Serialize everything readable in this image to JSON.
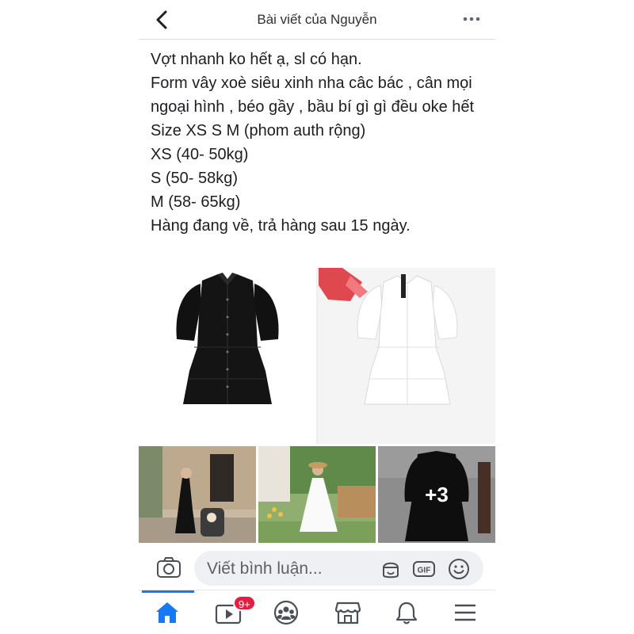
{
  "header": {
    "title": "Bài viết của Nguyễn"
  },
  "post": {
    "lines": [
      "Vợt nhanh ko hết ạ, sl có hạn.",
      "Form vây xoè siêu xinh nha câc bác , cân mọi ngoại hình , béo gầy , bầu bí gì gì đều oke hết",
      "Size XS S M (phom auth rộng)",
      "XS (40- 50kg)",
      "S (50- 58kg)",
      "M (58- 65kg)",
      "Hàng đang về, trả hàng sau 15 ngày."
    ]
  },
  "gallery": {
    "more_count": "+3"
  },
  "comment": {
    "placeholder": "Viết bình luận..."
  },
  "tabbar": {
    "video_badge": "9+"
  },
  "colors": {
    "accent": "#1877f2",
    "badge": "#e41e3f",
    "input_bg": "#eef0f3"
  }
}
